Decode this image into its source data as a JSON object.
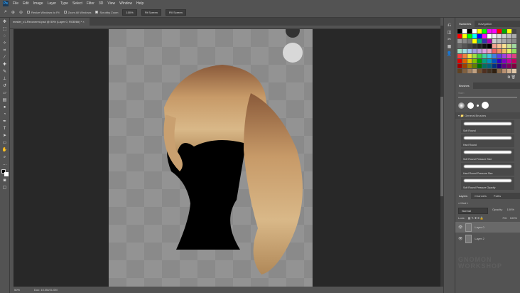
{
  "app": {
    "logo": "Ps"
  },
  "menu": [
    "File",
    "Edit",
    "Image",
    "Layer",
    "Type",
    "Select",
    "Filter",
    "3D",
    "View",
    "Window",
    "Help"
  ],
  "options": {
    "resize_windows": "Resize Windows to Fit",
    "zoom_all": "Zoom All Windows",
    "scrubby": "Scrubby Zoom",
    "zoom_pct": "100%",
    "fit_screen": "Fit Screen",
    "fill_screen": "Fill Screen"
  },
  "document_tab": {
    "title": "mesler_v1-Recovered.psd @ 50% (Layer 0, RGB/8#) *",
    "close": "×"
  },
  "status": {
    "zoom": "50%",
    "doc": "Doc: 10.0M/21.0M"
  },
  "swatches_panel": {
    "tabs": [
      "Swatches",
      "Navigation"
    ],
    "colors": [
      "#000000",
      "#ffffff",
      "#000000",
      "#ffffff",
      "#ffff00",
      "#00ff00",
      "#ff00ff",
      "#ff00ff",
      "#ff0000",
      "#00aa00",
      "#ffff00",
      "#444444",
      "#ff0000",
      "#ffff00",
      "#00ff00",
      "#00ffff",
      "#0000ff",
      "#ff00ff",
      "#ffffff",
      "#eeeeee",
      "#dddddd",
      "#cccccc",
      "#bbbbbb",
      "#aaaaaa",
      "#999999",
      "#888888",
      "#777777",
      "#ffff00",
      "#00aa88",
      "#3333aa",
      "#aa00aa",
      "#cccccc",
      "#bbbbbb",
      "#aaaaaa",
      "#999999",
      "#888888",
      "#666666",
      "#555555",
      "#444444",
      "#333333",
      "#222222",
      "#111111",
      "#000000",
      "#f4a090",
      "#f7c090",
      "#fbe090",
      "#c8e090",
      "#a0d8a0",
      "#a0e0c0",
      "#a0e0e0",
      "#a0c8f0",
      "#a0a0e0",
      "#c0a0e0",
      "#e0a0e0",
      "#f0a0c0",
      "#f06060",
      "#f09060",
      "#f0c060",
      "#e0f060",
      "#90e060",
      "#f04040",
      "#f08040",
      "#f0e040",
      "#a0e040",
      "#40d040",
      "#40d0a0",
      "#40c0e0",
      "#4080e0",
      "#6040e0",
      "#a040e0",
      "#e040c0",
      "#e04080",
      "#e00000",
      "#e06000",
      "#e0c000",
      "#80c000",
      "#00a000",
      "#00a080",
      "#0090c0",
      "#0050c0",
      "#3000c0",
      "#8000c0",
      "#c000a0",
      "#c00060",
      "#a00000",
      "#a04000",
      "#a08000",
      "#608000",
      "#007000",
      "#007060",
      "#006080",
      "#003080",
      "#200080",
      "#600080",
      "#800060",
      "#800040",
      "#604020",
      "#806040",
      "#a08060",
      "#c0a080",
      "#705030",
      "#503020",
      "#403020",
      "#302010",
      "#8a6a4a",
      "#b89070",
      "#d0b090",
      "#e0c8a8"
    ]
  },
  "brushes_panel": {
    "title": "Brushes",
    "size_label": "Size:",
    "group": "General Brushes",
    "brushes": [
      "Soft Round",
      "Hard Round",
      "Soft Round Pressure Size",
      "Hard Round Pressure Size",
      "Soft Round Pressure Opacity"
    ]
  },
  "layers_panel": {
    "tabs": [
      "Layers",
      "Channels",
      "Paths"
    ],
    "filter": "Kind",
    "blend": "Normal",
    "opacity_label": "Opacity:",
    "opacity": "100%",
    "lock_label": "Lock:",
    "fill_label": "Fill:",
    "fill": "100%",
    "layers": [
      {
        "name": "Layer 0",
        "selected": true
      },
      {
        "name": "Layer 2",
        "selected": false
      }
    ]
  },
  "watermark": "GNOMON WORKSHOP"
}
